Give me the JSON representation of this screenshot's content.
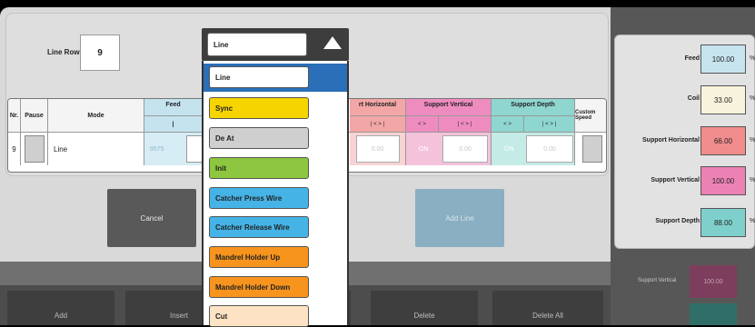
{
  "line_row": {
    "label": "Line Row",
    "value": "9"
  },
  "table": {
    "headers": {
      "nr": "Nr.",
      "pause": "Pause",
      "mode": "Mode",
      "feed": "Feed",
      "feed_sub": "I",
      "support_horizontal": "rt Horizontal",
      "support_vertical": "Support Vertical",
      "support_depth": "Support Depth",
      "custom_speed": "Custom Speed",
      "arrows_inner": "< >",
      "arrows_outer": "| < > |"
    },
    "row": {
      "nr": "9",
      "mode": "Line",
      "feed": "9575",
      "sh_value": "0.00",
      "sv_on": "ON",
      "sv_value": "0.00",
      "sd_on": "ON",
      "sd_value": "0.00"
    }
  },
  "buttons": {
    "cancel": "Cancel",
    "add_line": "Add Line",
    "bottom": [
      "Add",
      "Insert",
      "",
      "Delete",
      "Delete All"
    ]
  },
  "right_panel": {
    "feed": {
      "label": "Feed",
      "value": "100.00",
      "color": "#c6e4ee"
    },
    "coil": {
      "label": "Coil",
      "value": "33.00",
      "color": "#f8f3dc"
    },
    "support_horizontal": {
      "label": "Support Horizontal",
      "value": "66.00",
      "color": "#f08c8c"
    },
    "support_vertical": {
      "label": "Support Vertical",
      "value": "100.00",
      "color": "#ec82b4"
    },
    "support_depth": {
      "label": "Support Depth",
      "value": "88.00",
      "color": "#7fd0cc"
    },
    "unit": "%",
    "lower_label": "Support Vertical",
    "lower_value": "100.00"
  },
  "dropdown": {
    "current": "Line",
    "items": [
      {
        "label": "Line",
        "color": "#ffffff"
      },
      {
        "label": "Sync",
        "color": "#f5d400"
      },
      {
        "label": "De At",
        "color": "#cfcfcf"
      },
      {
        "label": "Init",
        "color": "#8dc63f"
      },
      {
        "label": "Catcher Press Wire",
        "color": "#45b3e6"
      },
      {
        "label": "Catcher Release Wire",
        "color": "#45b3e6"
      },
      {
        "label": "Mandrel Holder Up",
        "color": "#f7941d"
      },
      {
        "label": "Mandrel Holder Down",
        "color": "#f7941d"
      },
      {
        "label": "Cut",
        "color": "#fde3c4"
      }
    ]
  }
}
